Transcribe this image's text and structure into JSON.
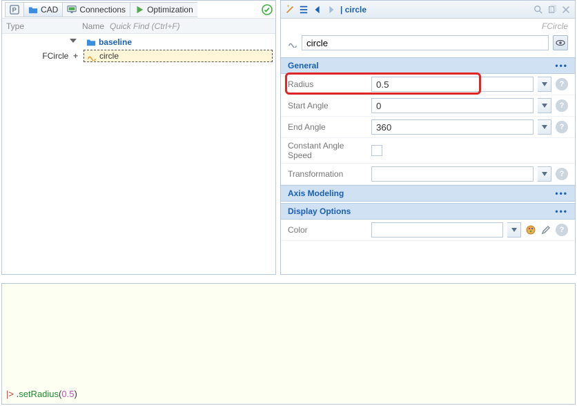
{
  "left": {
    "tabs": {
      "cad": "CAD",
      "connections": "Connections",
      "optimization": "Optimization"
    },
    "header": {
      "type": "Type",
      "name": "Name",
      "quick": "Quick Find (Ctrl+F)"
    },
    "tree": {
      "row1_type": "",
      "row1_label": "baseline",
      "row2_type": "FCircle",
      "row2_label": "circle"
    }
  },
  "right": {
    "title": "| circle",
    "subtitle": "FCircle",
    "name_value": "circle",
    "sections": {
      "general": "General",
      "axis": "Axis Modeling",
      "display": "Display Options"
    },
    "props": {
      "radius_label": "Radius",
      "radius_value": "0.5",
      "start_label": "Start Angle",
      "start_value": "0",
      "end_label": "End Angle",
      "end_value": "360",
      "cas_label": "Constant Angle Speed",
      "trans_label": "Transformation",
      "trans_value": "",
      "color_label": "Color",
      "color_value": ""
    }
  },
  "console": {
    "prompt": "|> ",
    "dot": ".",
    "fn": "setRadius",
    "open": "(",
    "arg": "0.5",
    "close": ")"
  }
}
